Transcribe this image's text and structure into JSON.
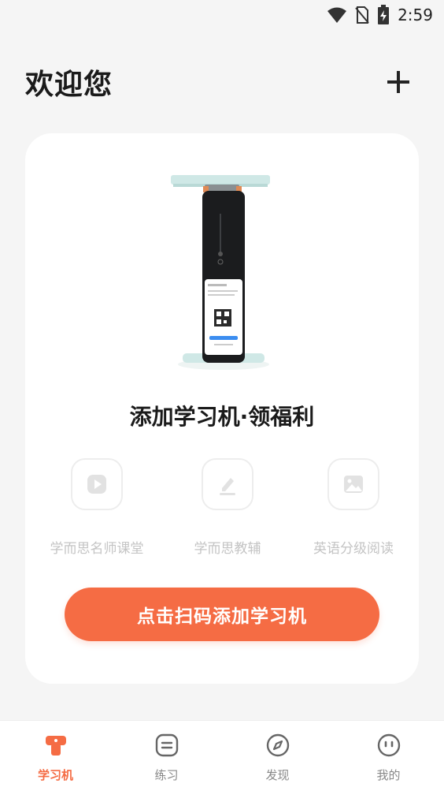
{
  "status_bar": {
    "time": "2:59"
  },
  "header": {
    "title": "欢迎您"
  },
  "card": {
    "title": "添加学习机·领福利",
    "features": [
      {
        "label": "学而思名师课堂",
        "icon": "play-icon"
      },
      {
        "label": "学而思教辅",
        "icon": "edit-icon"
      },
      {
        "label": "英语分级阅读",
        "icon": "image-icon"
      }
    ],
    "cta_label": "点击扫码添加学习机"
  },
  "tabs": [
    {
      "label": "学习机",
      "active": true
    },
    {
      "label": "练习",
      "active": false
    },
    {
      "label": "发现",
      "active": false
    },
    {
      "label": "我的",
      "active": false
    }
  ],
  "colors": {
    "accent": "#f56c44",
    "background": "#f5f5f5",
    "card": "#ffffff"
  }
}
